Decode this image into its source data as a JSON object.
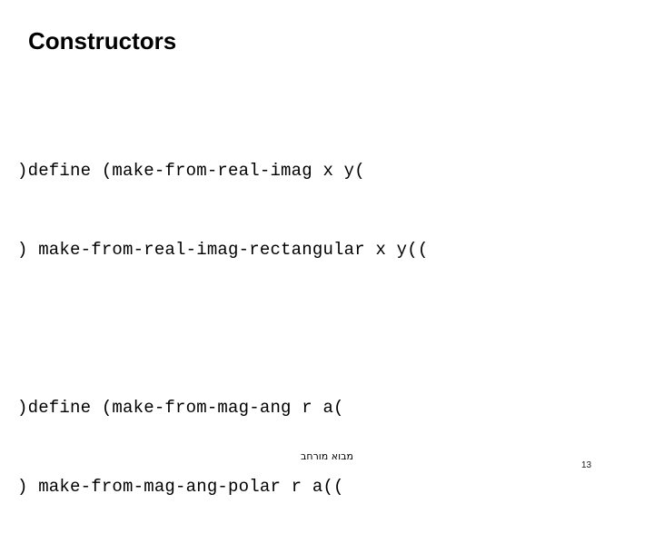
{
  "slide": {
    "title": "Constructors",
    "page_number": "13",
    "footer_note": "מבוא מורחב",
    "background_color": "#ffffff",
    "text_color": "#000000"
  },
  "code_blocks": [
    {
      "name": "make-from-real-imag",
      "lines": [
        ")define (make-from-real-imag x y(",
        ") make-from-real-imag-rectangular x y(("
      ]
    },
    {
      "name": "make-from-mag-ang",
      "lines": [
        ")define (make-from-mag-ang r a(",
        ") make-from-mag-ang-polar r a(("
      ]
    }
  ]
}
